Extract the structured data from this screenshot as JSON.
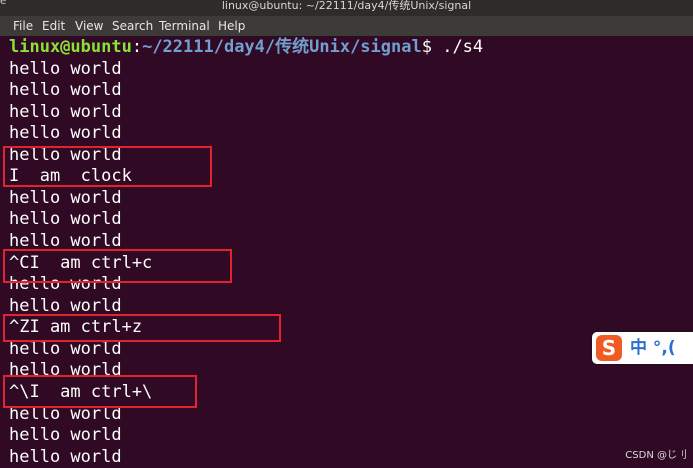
{
  "window": {
    "title": "linux@ubuntu: ~/22111/day4/传统Unix/signal",
    "corner_glyph": "e"
  },
  "menu": [
    "File",
    "Edit",
    "View",
    "Search",
    "Terminal",
    "Help"
  ],
  "prompt": {
    "user_host": "linux@ubuntu",
    "separator": ":",
    "path": "~/22111/day4/传统Unix/signal",
    "symbol": "$",
    "command": " ./s4"
  },
  "output_lines": [
    "hello world",
    "hello world",
    "hello world",
    "hello world",
    "hello world",
    "I  am  clock",
    "hello world",
    "hello world",
    "hello world",
    "^CI  am ctrl+c",
    "hello world",
    "hello world",
    "^ZI am ctrl+z",
    "hello world",
    "hello world",
    "^\\I  am ctrl+\\",
    "hello world",
    "hello world",
    "hello world"
  ],
  "ime": {
    "logo": "S",
    "text": "中 °,("
  },
  "watermark": "CSDN @じ刂",
  "colors": {
    "background": "#300a24",
    "prompt_user": "#8ae234",
    "prompt_path": "#729fcf",
    "highlight": "#e0232e"
  }
}
